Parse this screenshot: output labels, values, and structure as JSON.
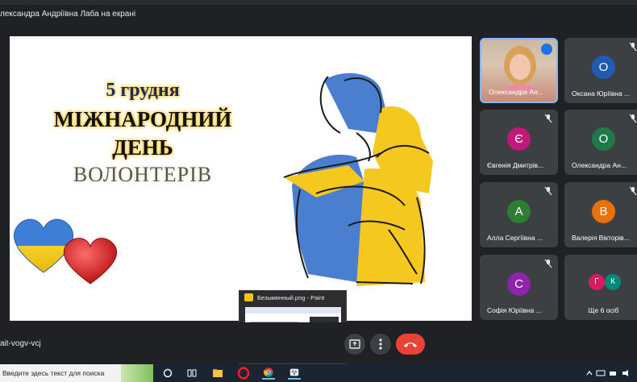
{
  "meeting": {
    "presenting_title": "лександра Андріївна Лаба на екрані",
    "meeting_code": "ait-vogv-vcj"
  },
  "slide": {
    "date_line": "5 грудня",
    "line2": "МІЖНАРОДНИЙ",
    "line3": "ДЕНЬ",
    "line4": "ВОЛОНТЕРІВ"
  },
  "participants": [
    {
      "name": "Олександра Ан...",
      "initial": "",
      "color": "",
      "video": true
    },
    {
      "name": "Оксана Юріївна ...",
      "initial": "О",
      "color": "#1e5bb5",
      "video": false
    },
    {
      "name": "Євгенія Дмитрів...",
      "initial": "Є",
      "color": "#c2187a",
      "video": false
    },
    {
      "name": "Олександра Ан...",
      "initial": "О",
      "color": "#1f7a4a",
      "video": false
    },
    {
      "name": "Алла Сергіївна ...",
      "initial": "А",
      "color": "#2e7d32",
      "video": false
    },
    {
      "name": "Валерія Вікторів...",
      "initial": "В",
      "color": "#e8710a",
      "video": false
    },
    {
      "name": "Софія Юріївна ...",
      "initial": "С",
      "color": "#8e24aa",
      "video": false
    }
  ],
  "overflow_tile": {
    "label": "Ще 6 осіб",
    "avatars": [
      "Г",
      "К"
    ],
    "colors": [
      "#d81b60",
      "#00897b"
    ]
  },
  "paint_preview": {
    "title": "Безымянный.png - Paint"
  },
  "taskbar": {
    "search_placeholder": "Введите здесь текст для поиска"
  }
}
